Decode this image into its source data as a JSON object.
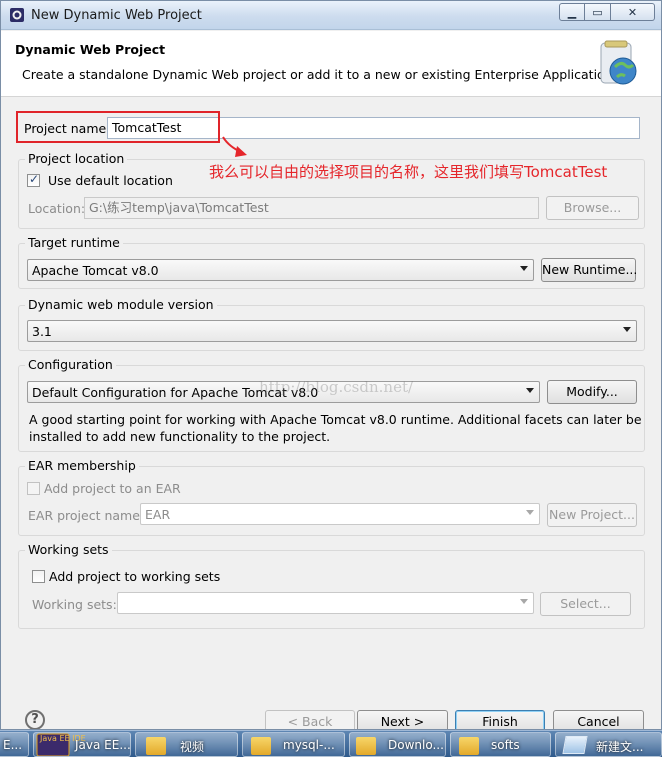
{
  "window": {
    "title": "New Dynamic Web Project"
  },
  "banner": {
    "title": "Dynamic Web Project",
    "description": "Create a standalone Dynamic Web project or add it to a new or existing Enterprise Application."
  },
  "project_name": {
    "label": "Project name:",
    "value": "TomcatTest"
  },
  "project_location": {
    "title": "Project location",
    "use_default_label": "Use default location",
    "use_default_checked": true,
    "location_label": "Location:",
    "location_value": "G:\\练习temp\\java\\TomcatTest",
    "browse_label": "Browse..."
  },
  "annotation": "我么可以自由的选择项目的名称，这里我们填写TomcatTest",
  "target_runtime": {
    "title": "Target runtime",
    "selected": "Apache Tomcat v8.0",
    "new_runtime_label": "New Runtime..."
  },
  "module_version": {
    "title": "Dynamic web module version",
    "selected": "3.1"
  },
  "configuration": {
    "title": "Configuration",
    "selected": "Default Configuration for Apache Tomcat v8.0",
    "modify_label": "Modify...",
    "description_line1": "A good starting point for working with Apache Tomcat v8.0 runtime. Additional facets can later be",
    "description_line2": "installed to add new functionality to the project."
  },
  "watermark": "http://blog.csdn.net/",
  "ear": {
    "title": "EAR membership",
    "add_label": "Add project to an EAR",
    "project_name_label": "EAR project name:",
    "project_name_value": "EAR",
    "new_project_label": "New Project..."
  },
  "working_sets": {
    "title": "Working sets",
    "add_label": "Add project to working sets",
    "sets_label": "Working sets:",
    "select_label": "Select..."
  },
  "footer": {
    "help": "?",
    "back": "< Back",
    "next": "Next >",
    "finish": "Finish",
    "cancel": "Cancel"
  },
  "taskbar": {
    "items": [
      {
        "label": "E..."
      },
      {
        "label": "Java EE..."
      },
      {
        "label": "视频"
      },
      {
        "label": "mysql-..."
      },
      {
        "label": "Downlo..."
      },
      {
        "label": "softs"
      },
      {
        "label": "新建文..."
      }
    ],
    "javaee_icon_text": "Java EE IDE"
  },
  "colors": {
    "annotation": "#e5262b",
    "highlight_box": "#e0242a",
    "taskbar": "#2f5a8c"
  }
}
